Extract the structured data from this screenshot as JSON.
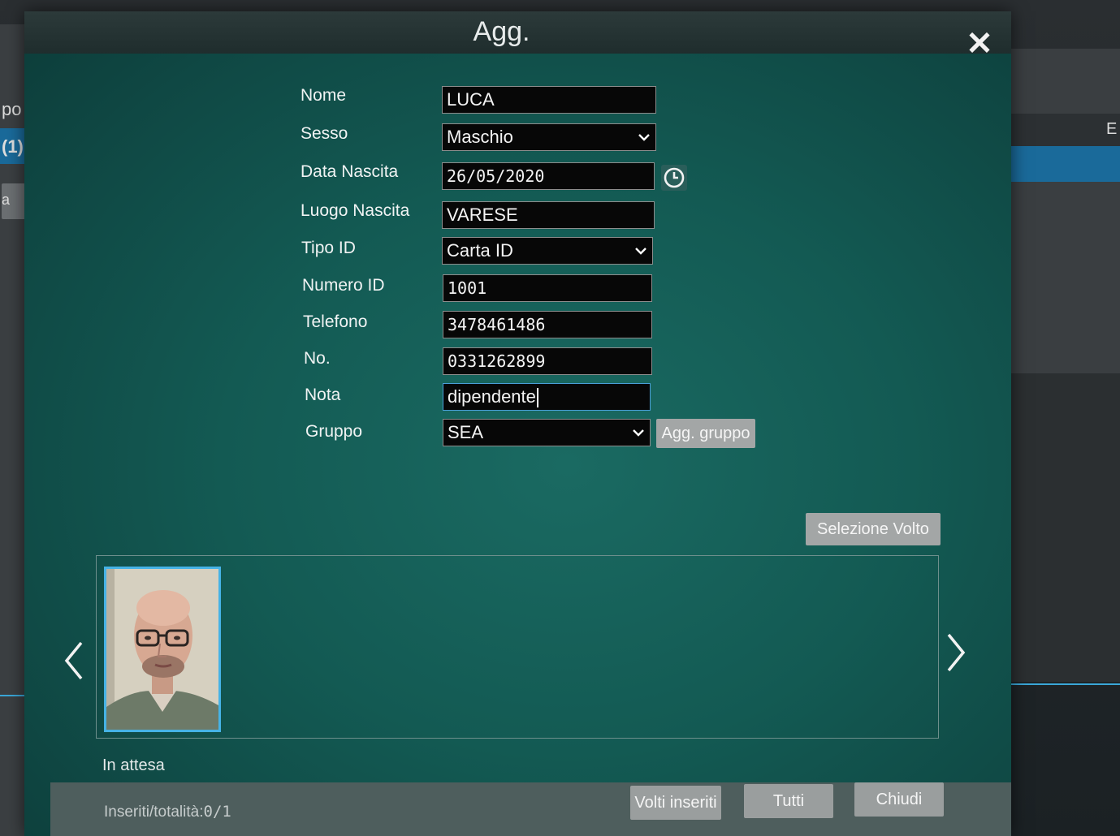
{
  "background": {
    "left_texts": [
      "po",
      "(1)",
      "a"
    ],
    "right_letter": "E"
  },
  "dialog": {
    "title": "Agg.",
    "close_icon": "close-icon"
  },
  "form": {
    "nome": {
      "label": "Nome",
      "value": "LUCA"
    },
    "sesso": {
      "label": "Sesso",
      "value": "Maschio"
    },
    "data_nascita": {
      "label": "Data Nascita",
      "value": "26/05/2020"
    },
    "luogo_nascita": {
      "label": "Luogo Nascita",
      "value": "VARESE"
    },
    "tipo_id": {
      "label": "Tipo ID",
      "value": "Carta ID"
    },
    "numero_id": {
      "label": "Numero ID",
      "value": "1001"
    },
    "telefono": {
      "label": "Telefono",
      "value": "3478461486"
    },
    "no": {
      "label": "No.",
      "value": "0331262899"
    },
    "nota": {
      "label": "Nota",
      "value": "dipendente"
    },
    "gruppo": {
      "label": "Gruppo",
      "value": "SEA"
    }
  },
  "buttons": {
    "agg_gruppo": "Agg. gruppo",
    "selezione_volto": "Selezione Volto",
    "volti_inseriti": "Volti inseriti",
    "tutti": "Tutti",
    "chiudi": "Chiudi"
  },
  "status": {
    "state": "In attesa",
    "count_label": "Inseriti/totalità:",
    "count_value": "0/1"
  },
  "colors": {
    "dialog_bg": "#135a53",
    "field_bg": "#070707",
    "accent": "#46b3e6",
    "button_grey": "#a3a6a6"
  }
}
